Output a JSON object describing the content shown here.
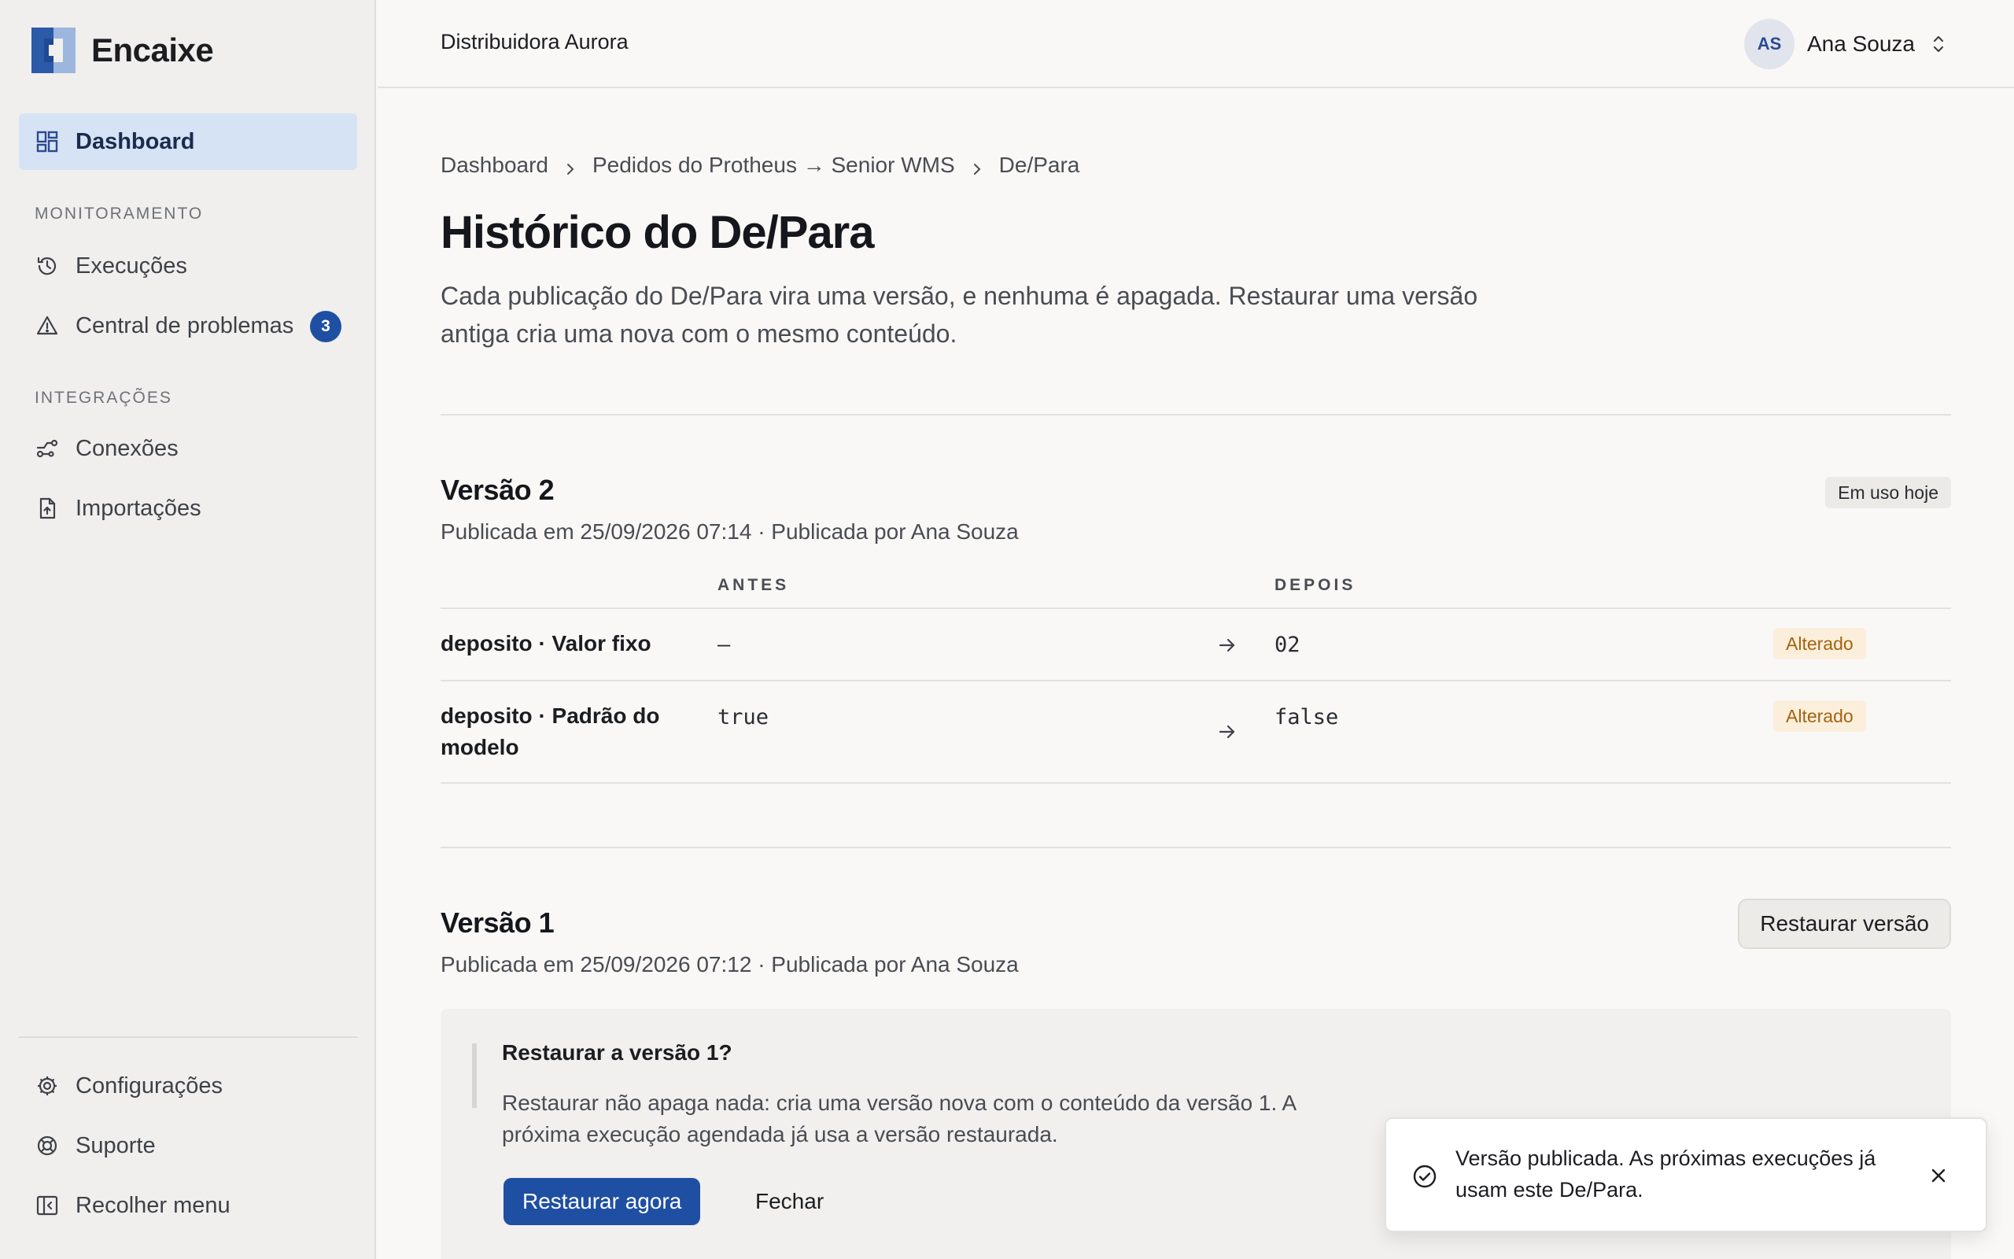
{
  "app": {
    "name": "Encaixe"
  },
  "sidebar": {
    "dashboard_label": "Dashboard",
    "section_monitoring": "MONITORAMENTO",
    "executions_label": "Execuções",
    "problems_label": "Central de problemas",
    "problems_count": "3",
    "section_integrations": "INTEGRAÇÕES",
    "connections_label": "Conexões",
    "imports_label": "Importações",
    "settings_label": "Configurações",
    "support_label": "Suporte",
    "collapse_label": "Recolher menu"
  },
  "header": {
    "org_name": "Distribuidora Aurora",
    "user_initials": "AS",
    "user_name": "Ana Souza"
  },
  "breadcrumb": {
    "items": [
      "Dashboard",
      "Pedidos do Protheus → Senior WMS",
      "De/Para"
    ]
  },
  "page": {
    "title": "Histórico do De/Para",
    "description": "Cada publicação do De/Para vira uma versão, e nenhuma é apagada. Restaurar uma versão antiga cria uma nova com o mesmo conteúdo."
  },
  "versions": [
    {
      "title": "Versão 2",
      "meta": "Publicada em 25/09/2026 07:14 · Publicada por Ana Souza",
      "status_tag": "Em uso hoje",
      "columns": {
        "before": "ANTES",
        "after": "DEPOIS"
      },
      "changes": [
        {
          "field": "deposito · Valor fixo",
          "before": "—",
          "after": "02",
          "status": "Alterado"
        },
        {
          "field": "deposito · Padrão do modelo",
          "before": "true",
          "after": "false",
          "status": "Alterado"
        }
      ]
    },
    {
      "title": "Versão 1",
      "meta": "Publicada em 25/09/2026 07:12 · Publicada por Ana Souza",
      "restore_label": "Restaurar versão"
    }
  ],
  "confirm": {
    "title": "Restaurar a versão 1?",
    "text": "Restaurar não apaga nada: cria uma versão nova com o conteúdo da versão 1. A próxima execução agendada já usa a versão restaurada.",
    "primary_label": "Restaurar agora",
    "secondary_label": "Fechar"
  },
  "toast": {
    "message": "Versão publicada. As próximas execuções já usam este De/Para."
  },
  "colors": {
    "accent": "#1f4fa3",
    "active_nav_bg": "#d6e3f5",
    "changed_tag_bg": "#fbefdc",
    "changed_tag_text": "#a4620f"
  }
}
